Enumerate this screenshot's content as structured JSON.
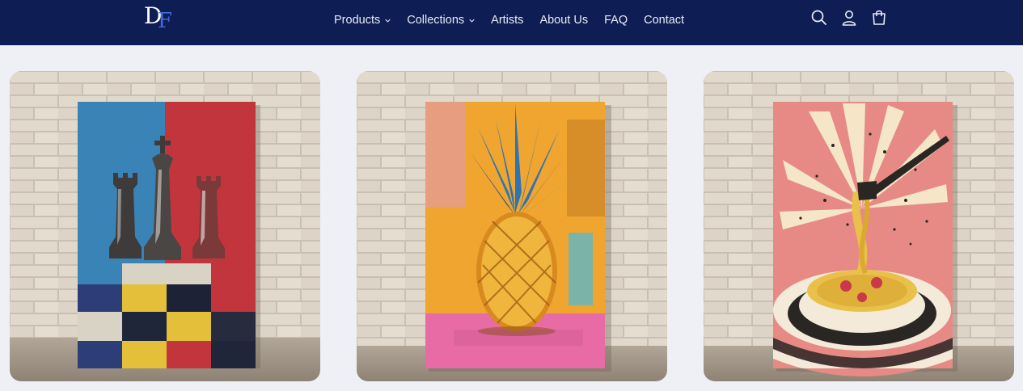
{
  "header": {
    "logo": {
      "letter1": "D",
      "letter2": "F"
    },
    "nav": [
      {
        "label": "Products",
        "dropdown": true
      },
      {
        "label": "Collections",
        "dropdown": true
      },
      {
        "label": "Artists",
        "dropdown": false
      },
      {
        "label": "About Us",
        "dropdown": false
      },
      {
        "label": "FAQ",
        "dropdown": false
      },
      {
        "label": "Contact",
        "dropdown": false
      }
    ],
    "icons": [
      "search-icon",
      "account-icon",
      "cart-icon"
    ]
  },
  "colors": {
    "header_bg": "#0f1d55",
    "page_bg": "#eef0f6",
    "logo_accent": "#3f6ad8"
  },
  "products": [
    {
      "image": "chess-pieces-painting"
    },
    {
      "image": "pineapple-painting"
    },
    {
      "image": "spaghetti-painting"
    }
  ]
}
